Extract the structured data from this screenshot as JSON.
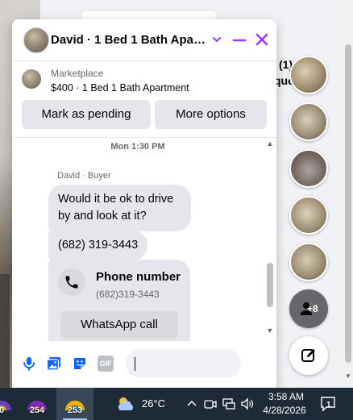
{
  "background": {
    "right_fragment_line1": "(1)",
    "right_fragment_line2": "que"
  },
  "chat": {
    "title": "David · 1 Bed 1 Bath Apart...",
    "listing": {
      "source": "Marketplace",
      "price_title": "$400 · 1 Bed 1 Bath Apartment",
      "mark_pending_label": "Mark as pending",
      "more_options_label": "More options"
    },
    "timestamp": "Mon 1:30 PM",
    "sender": "David · Buyer",
    "messages": [
      {
        "text": "Would it be ok to drive by and look at it?"
      },
      {
        "text": "(682) 319-3443"
      }
    ],
    "phone_card": {
      "title": "Phone number",
      "number": "(682)319-3443",
      "action_label": "WhatsApp call"
    },
    "composer": {
      "gif_label": "GIF"
    },
    "accent_color": "#a033ff"
  },
  "chat_heads": {
    "more_count": "+8"
  },
  "taskbar": {
    "app_badges": [
      "0",
      "254",
      "253"
    ],
    "temperature": "26°C",
    "time": "3:58 AM",
    "date": "4/28/2026",
    "notification_count": "1"
  }
}
